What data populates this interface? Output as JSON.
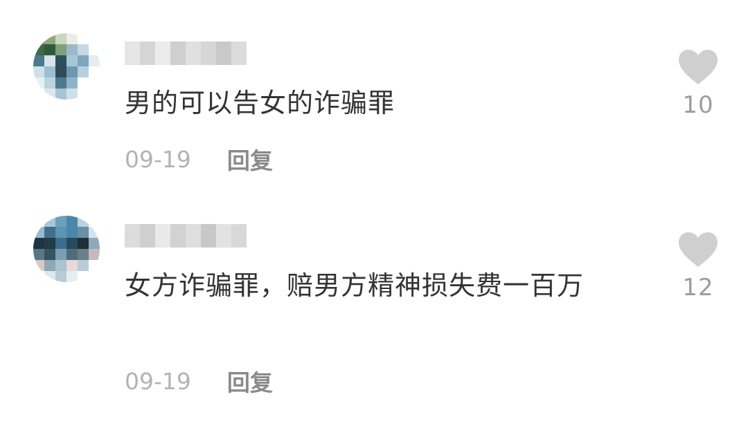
{
  "colors": {
    "heart": "#cfcfcf",
    "text": "#333333",
    "date": "#b3b3b3",
    "reply": "#8a8a8a",
    "count": "#9c9c9c"
  },
  "comments": [
    {
      "text": "男的可以告女的诈骗罪",
      "date": "09-19",
      "reply_label": "回复",
      "likes": "10",
      "like_icon": "heart-icon",
      "avatar_pixels": [
        "#6b8a5e",
        "#8fa878",
        "#c9d6c0",
        "#e9efe6",
        "#ffffff",
        "#ffffff",
        "#3e6b43",
        "#2f5a3a",
        "#7fa07a",
        "#9db8c8",
        "#c6d8e4",
        "#ffffff",
        "#4a7a8e",
        "#d7e4ec",
        "#2e4f5e",
        "#aac6d6",
        "#7ea6bd",
        "#e4edf2",
        "#cfe0ea",
        "#9bbfd3",
        "#2f4c5a",
        "#6f98ae",
        "#b7d0de",
        "#ffffff",
        "#e8f0f5",
        "#bcd3e0",
        "#4d7a90",
        "#8fb4c8",
        "#ffffff",
        "#ffffff",
        "#ffffff",
        "#dce8ef",
        "#a9c5d5",
        "#cfe0ea",
        "#ffffff",
        "#ffffff"
      ],
      "username_pixels": [
        "#e6e6e6",
        "#d5d5d5",
        "#ececec",
        "#cfcfcf",
        "#e0e0e0",
        "#d6d6d6",
        "#c9c9c9",
        "#dcdcdc"
      ]
    },
    {
      "text": "女方诈骗罪，赔男方精神损失费一百万",
      "date": "09-19",
      "reply_label": "回复",
      "likes": "12",
      "like_icon": "heart-icon",
      "avatar_pixels": [
        "#ffffff",
        "#a9c7d8",
        "#6f9fba",
        "#4c87a8",
        "#b9d2e0",
        "#ffffff",
        "#9ab9cc",
        "#3f6f8a",
        "#5c94b4",
        "#4a86a8",
        "#6a8fa6",
        "#d5e3ec",
        "#1f3440",
        "#223b48",
        "#3a6e8c",
        "#2a4a5c",
        "#1e2f38",
        "#8eaabc",
        "#5a7584",
        "#36535f",
        "#7a9eb2",
        "#4e6c7c",
        "#6b7f8a",
        "#c8b8b8",
        "#d9c8c8",
        "#8fa8b4",
        "#a9c3d0",
        "#e8d8d8",
        "#b9cbd4",
        "#ffffff",
        "#ffffff",
        "#dde8ee",
        "#b7ccd8",
        "#e5eef2",
        "#ffffff",
        "#ffffff"
      ],
      "username_pixels": [
        "#dcdcdc",
        "#cfcfcf",
        "#e9e9e9",
        "#d2d2d2",
        "#dedede",
        "#c8c8c8",
        "#e2e2e2",
        "#d8d8d8"
      ]
    }
  ]
}
